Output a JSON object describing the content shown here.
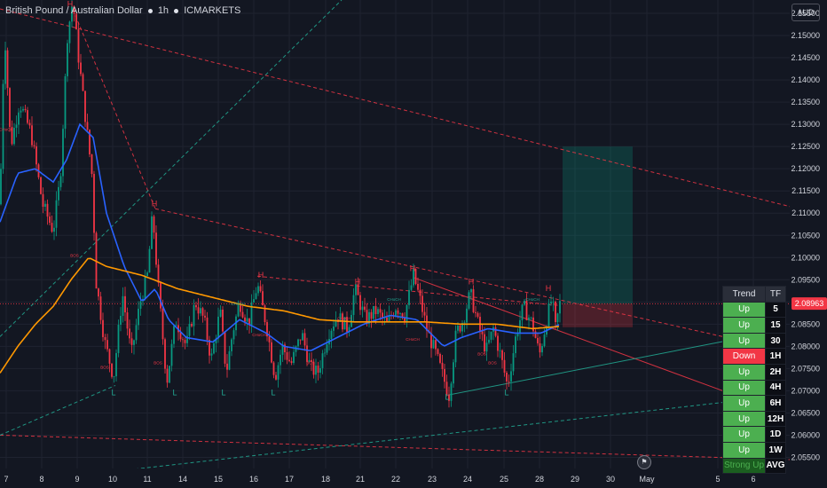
{
  "header": {
    "symbol": "British Pound / Australian Dollar",
    "interval": "1h",
    "broker": "ICMARKETS",
    "currency": "AUD"
  },
  "chart_data": {
    "type": "candlestick",
    "x_tick_labels": [
      "7",
      "8",
      "9",
      "10",
      "11",
      "14",
      "15",
      "16",
      "17",
      "18",
      "21",
      "22",
      "23",
      "24",
      "25",
      "28",
      "29",
      "30",
      "May",
      "5",
      "6"
    ],
    "y_tick_labels": [
      "2.15500",
      "2.15000",
      "2.14500",
      "2.14000",
      "2.13500",
      "2.13000",
      "2.12500",
      "2.12000",
      "2.11500",
      "2.11000",
      "2.10500",
      "2.10000",
      "2.09500",
      "2.09000",
      "2.08500",
      "2.08000",
      "2.07500",
      "2.07000",
      "2.06500",
      "2.06000",
      "2.05500"
    ],
    "ylim": [
      2.0525,
      2.158
    ],
    "last_price": "2.08963",
    "price_anchors": [
      [
        0,
        2.112
      ],
      [
        5,
        2.152
      ],
      [
        12,
        2.125
      ],
      [
        22,
        2.135
      ],
      [
        35,
        2.128
      ],
      [
        48,
        2.112
      ],
      [
        60,
        2.106
      ],
      [
        68,
        2.118
      ],
      [
        76,
        2.15
      ],
      [
        82,
        2.158
      ],
      [
        88,
        2.146
      ],
      [
        96,
        2.132
      ],
      [
        104,
        2.118
      ],
      [
        108,
        2.095
      ],
      [
        118,
        2.081
      ],
      [
        128,
        2.073
      ],
      [
        138,
        2.092
      ],
      [
        148,
        2.078
      ],
      [
        158,
        2.09
      ],
      [
        166,
        2.096
      ],
      [
        172,
        2.11
      ],
      [
        178,
        2.094
      ],
      [
        188,
        2.072
      ],
      [
        198,
        2.086
      ],
      [
        210,
        2.08
      ],
      [
        220,
        2.09
      ],
      [
        230,
        2.086
      ],
      [
        238,
        2.077
      ],
      [
        248,
        2.088
      ],
      [
        255,
        2.074
      ],
      [
        262,
        2.083
      ],
      [
        270,
        2.09
      ],
      [
        280,
        2.085
      ],
      [
        290,
        2.094
      ],
      [
        300,
        2.085
      ],
      [
        310,
        2.073
      ],
      [
        318,
        2.08
      ],
      [
        328,
        2.076
      ],
      [
        340,
        2.083
      ],
      [
        350,
        2.075
      ],
      [
        358,
        2.074
      ],
      [
        370,
        2.083
      ],
      [
        380,
        2.087
      ],
      [
        392,
        2.084
      ],
      [
        400,
        2.093
      ],
      [
        412,
        2.086
      ],
      [
        424,
        2.088
      ],
      [
        436,
        2.085
      ],
      [
        446,
        2.089
      ],
      [
        456,
        2.087
      ],
      [
        466,
        2.096
      ],
      [
        474,
        2.09
      ],
      [
        482,
        2.083
      ],
      [
        490,
        2.079
      ],
      [
        498,
        2.074
      ],
      [
        506,
        2.069
      ],
      [
        514,
        2.083
      ],
      [
        522,
        2.086
      ],
      [
        530,
        2.092
      ],
      [
        540,
        2.084
      ],
      [
        548,
        2.079
      ],
      [
        556,
        2.084
      ],
      [
        564,
        2.078
      ],
      [
        572,
        2.071
      ],
      [
        582,
        2.083
      ],
      [
        590,
        2.089
      ],
      [
        600,
        2.085
      ],
      [
        608,
        2.078
      ],
      [
        616,
        2.086
      ],
      [
        622,
        2.091
      ],
      [
        626,
        2.084
      ],
      [
        631,
        2.0896
      ]
    ],
    "ema_fast_anchors": [
      [
        0,
        2.108
      ],
      [
        20,
        2.119
      ],
      [
        40,
        2.12
      ],
      [
        60,
        2.117
      ],
      [
        75,
        2.122
      ],
      [
        90,
        2.13
      ],
      [
        105,
        2.127
      ],
      [
        120,
        2.11
      ],
      [
        140,
        2.098
      ],
      [
        160,
        2.09
      ],
      [
        175,
        2.093
      ],
      [
        190,
        2.086
      ],
      [
        210,
        2.082
      ],
      [
        240,
        2.081
      ],
      [
        270,
        2.086
      ],
      [
        300,
        2.083
      ],
      [
        320,
        2.08
      ],
      [
        350,
        2.079
      ],
      [
        380,
        2.082
      ],
      [
        410,
        2.085
      ],
      [
        440,
        2.087
      ],
      [
        470,
        2.086
      ],
      [
        500,
        2.08
      ],
      [
        520,
        2.082
      ],
      [
        550,
        2.084
      ],
      [
        580,
        2.083
      ],
      [
        610,
        2.083
      ],
      [
        631,
        2.085
      ]
    ],
    "ema_slow_anchors": [
      [
        0,
        2.074
      ],
      [
        20,
        2.08
      ],
      [
        40,
        2.085
      ],
      [
        60,
        2.089
      ],
      [
        80,
        2.095
      ],
      [
        100,
        2.1
      ],
      [
        120,
        2.098
      ],
      [
        160,
        2.096
      ],
      [
        200,
        2.093
      ],
      [
        240,
        2.091
      ],
      [
        280,
        2.089
      ],
      [
        320,
        2.088
      ],
      [
        360,
        2.086
      ],
      [
        400,
        2.0855
      ],
      [
        440,
        2.0855
      ],
      [
        480,
        2.0855
      ],
      [
        520,
        2.085
      ],
      [
        560,
        2.085
      ],
      [
        600,
        2.084
      ],
      [
        631,
        2.0845
      ]
    ],
    "structure_labels": [
      {
        "text": "H",
        "x": 79,
        "y": 2.1565,
        "color": "red"
      },
      {
        "text": "H",
        "x": 174,
        "y": 2.1115,
        "color": "red"
      },
      {
        "text": "H",
        "x": 294,
        "y": 2.0955,
        "color": "red"
      },
      {
        "text": "H",
        "x": 403,
        "y": 2.094,
        "color": "red"
      },
      {
        "text": "H",
        "x": 465,
        "y": 2.097,
        "color": "red"
      },
      {
        "text": "H",
        "x": 531,
        "y": 2.094,
        "color": "red"
      },
      {
        "text": "H",
        "x": 618,
        "y": 2.0925,
        "color": "red"
      },
      {
        "text": "L",
        "x": 128,
        "y": 2.069,
        "color": "green"
      },
      {
        "text": "L",
        "x": 197,
        "y": 2.069,
        "color": "green"
      },
      {
        "text": "L",
        "x": 252,
        "y": 2.069,
        "color": "green"
      },
      {
        "text": "L",
        "x": 308,
        "y": 2.069,
        "color": "green"
      },
      {
        "text": "L",
        "x": 504,
        "y": 2.068,
        "color": "green"
      },
      {
        "text": "L",
        "x": 571,
        "y": 2.069,
        "color": "green"
      },
      {
        "text": "BOS",
        "x": 84,
        "y": 2.1002,
        "color": "red"
      },
      {
        "text": "BOS",
        "x": 118,
        "y": 2.075,
        "color": "red"
      },
      {
        "text": "BOS",
        "x": 178,
        "y": 2.076,
        "color": "red"
      },
      {
        "text": "BOS",
        "x": 350,
        "y": 2.076,
        "color": "red"
      },
      {
        "text": "BOS",
        "x": 555,
        "y": 2.076,
        "color": "red"
      },
      {
        "text": "BOS",
        "x": 543,
        "y": 2.078,
        "color": "red"
      },
      {
        "text": "CHoCH",
        "x": 7,
        "y": 2.1285,
        "color": "red"
      },
      {
        "text": "CHoCH",
        "x": 268,
        "y": 2.0893,
        "color": "green"
      },
      {
        "text": "CHoCH",
        "x": 292,
        "y": 2.0823,
        "color": "red"
      },
      {
        "text": "CHoCH",
        "x": 388,
        "y": 2.086,
        "color": "red"
      },
      {
        "text": "CHoCH",
        "x": 444,
        "y": 2.0903,
        "color": "green"
      },
      {
        "text": "CHoCH",
        "x": 465,
        "y": 2.0813,
        "color": "red"
      },
      {
        "text": "CHoCH",
        "x": 600,
        "y": 2.0903,
        "color": "green"
      }
    ],
    "trendlines": [
      {
        "from": [
          0,
          2.156
        ],
        "to": [
          890,
          2.1115
        ],
        "color": "red",
        "style": "dashed"
      },
      {
        "from": [
          85,
          2.1545
        ],
        "to": [
          175,
          2.111
        ],
        "color": "red",
        "style": "dashed"
      },
      {
        "from": [
          175,
          2.111
        ],
        "to": [
          830,
          2.0815
        ],
        "color": "red",
        "style": "dashed"
      },
      {
        "from": [
          0,
          2.06
        ],
        "to": [
          890,
          2.0545
        ],
        "color": "red",
        "style": "dashed"
      },
      {
        "from": [
          290,
          2.0958
        ],
        "to": [
          630,
          2.0892
        ],
        "color": "red",
        "style": "dashed"
      },
      {
        "from": [
          466,
          2.0955
        ],
        "to": [
          820,
          2.0696
        ],
        "color": "red",
        "style": "solid"
      },
      {
        "from": [
          504,
          2.069
        ],
        "to": [
          820,
          2.0813
        ],
        "color": "green",
        "style": "solid"
      },
      {
        "from": [
          0,
          2.0822
        ],
        "to": [
          385,
          2.158
        ],
        "color": "green",
        "style": "dashed"
      },
      {
        "from": [
          0,
          2.06
        ],
        "to": [
          130,
          2.0712
        ],
        "color": "green",
        "style": "dashed"
      },
      {
        "from": [
          145,
          2.0522
        ],
        "to": [
          820,
          2.0675
        ],
        "color": "green",
        "style": "dashed"
      },
      {
        "from": [
          0,
          2.0896
        ],
        "to": [
          932,
          2.0896
        ],
        "color": "red",
        "style": "dotted"
      }
    ],
    "position": {
      "x_from": 634,
      "x_to": 713,
      "entry": 2.0896,
      "target": 2.125,
      "stop": 2.0843
    },
    "grid": true
  },
  "trend_table": {
    "headers": [
      "Trend",
      "TF"
    ],
    "rows": [
      {
        "trend": "Up",
        "tf": "5",
        "state": "up"
      },
      {
        "trend": "Up",
        "tf": "15",
        "state": "up"
      },
      {
        "trend": "Up",
        "tf": "30",
        "state": "up"
      },
      {
        "trend": "Down",
        "tf": "1H",
        "state": "down"
      },
      {
        "trend": "Up",
        "tf": "2H",
        "state": "up"
      },
      {
        "trend": "Up",
        "tf": "4H",
        "state": "up"
      },
      {
        "trend": "Up",
        "tf": "6H",
        "state": "up"
      },
      {
        "trend": "Up",
        "tf": "12H",
        "state": "up"
      },
      {
        "trend": "Up",
        "tf": "1D",
        "state": "up"
      },
      {
        "trend": "Up",
        "tf": "1W",
        "state": "up"
      },
      {
        "trend": "Strong Up",
        "tf": "AVG",
        "state": "strong"
      }
    ]
  },
  "colors": {
    "background": "#131722",
    "grid": "#1f2330",
    "up": "#089981",
    "down": "#f23645",
    "ema_fast": "#2962ff",
    "ema_slow": "#ff9800",
    "text": "#d1d4dc",
    "price_tag": "#f23645"
  }
}
